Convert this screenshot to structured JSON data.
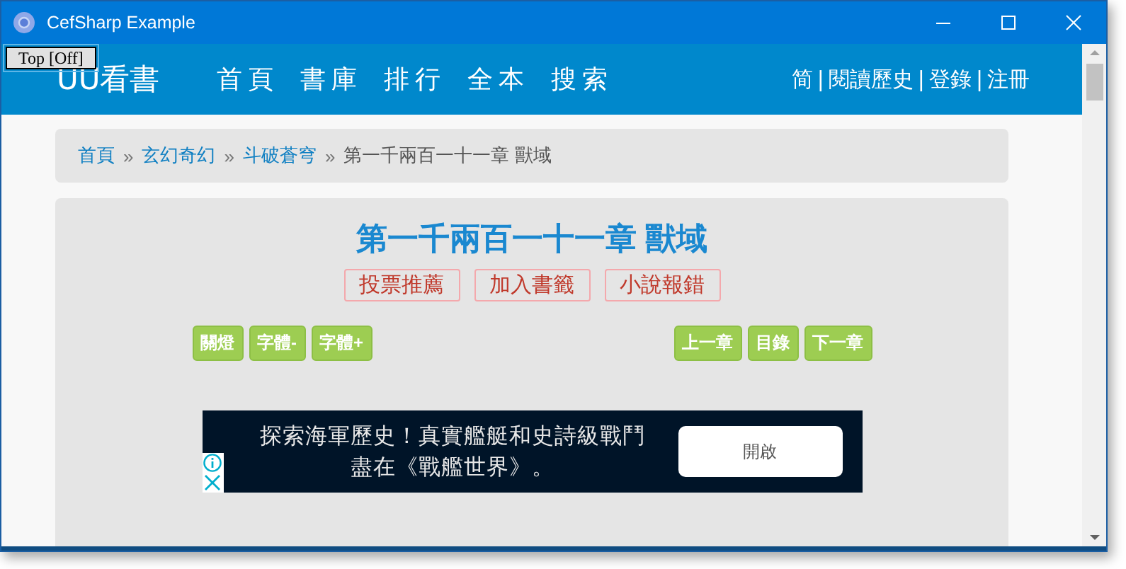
{
  "window": {
    "title": "CefSharp Example"
  },
  "top_button": "Top [Off]",
  "nav": {
    "logo": "UU看書",
    "links": [
      "首頁",
      "書庫",
      "排行",
      "全本",
      "搜索"
    ],
    "separator": "|",
    "user_links": [
      "简",
      "閱讀歷史",
      "登錄",
      "注冊"
    ]
  },
  "breadcrumb": {
    "separator": "»",
    "items": [
      {
        "text": "首頁",
        "link": true
      },
      {
        "text": "玄幻奇幻",
        "link": true
      },
      {
        "text": "斗破蒼穹",
        "link": true
      },
      {
        "text": "第一千兩百一十一章 獸域",
        "link": false
      }
    ]
  },
  "chapter": {
    "title": "第一千兩百一十一章 獸域",
    "actions": [
      "投票推薦",
      "加入書籤",
      "小說報錯"
    ],
    "left_tools": [
      "關燈",
      "字體-",
      "字體+"
    ],
    "right_tools": [
      "上一章",
      "目錄",
      "下一章"
    ]
  },
  "ad": {
    "lines": [
      "探索海軍歷史！真實艦艇和史詩級戰鬥",
      "盡在《戰艦世界》。"
    ],
    "button": "開啟"
  }
}
